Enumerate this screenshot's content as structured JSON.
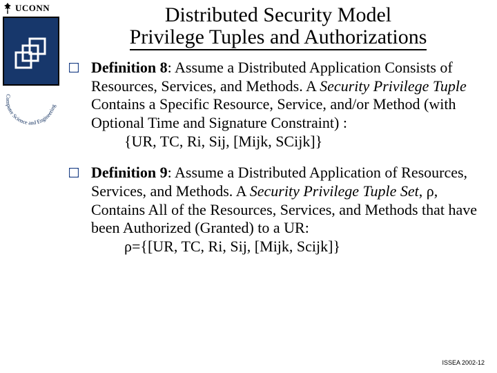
{
  "brand": {
    "wordmark": "UCONN",
    "arc_text": "Computer Science and Engineering"
  },
  "title": {
    "line1": "Distributed Security Model",
    "line2": "Privilege Tuples and Authorizations"
  },
  "items": [
    {
      "lead_bold": "Definition 8",
      "after_lead": ": Assume a Distributed Application Consists of Resources, Services, and Methods. A ",
      "italic": "Security Privilege Tuple",
      "after_italic": " Contains a Specific Resource, Service, and/or Method (with Optional Time and Signature Constraint) :",
      "tuple": "{UR, TC, Ri, Sij, [Mijk, SCijk]}"
    },
    {
      "lead_bold": "Definition 9",
      "after_lead": ": Assume a Distributed Application of Resources, Services, and Methods.  A ",
      "italic": "Security Privilege Tuple Set",
      "after_italic_pre_symbol": ", ",
      "symbol": "ρ",
      "after_symbol": ", Contains All of the Resources, Services, and Methods that have been Authorized (Granted) to a UR:",
      "tuple_pre": "ρ",
      "tuple_post": "={[UR, TC, Ri, Sij, [Mijk, Scijk]}"
    }
  ],
  "footer": "ISSEA 2002-12"
}
